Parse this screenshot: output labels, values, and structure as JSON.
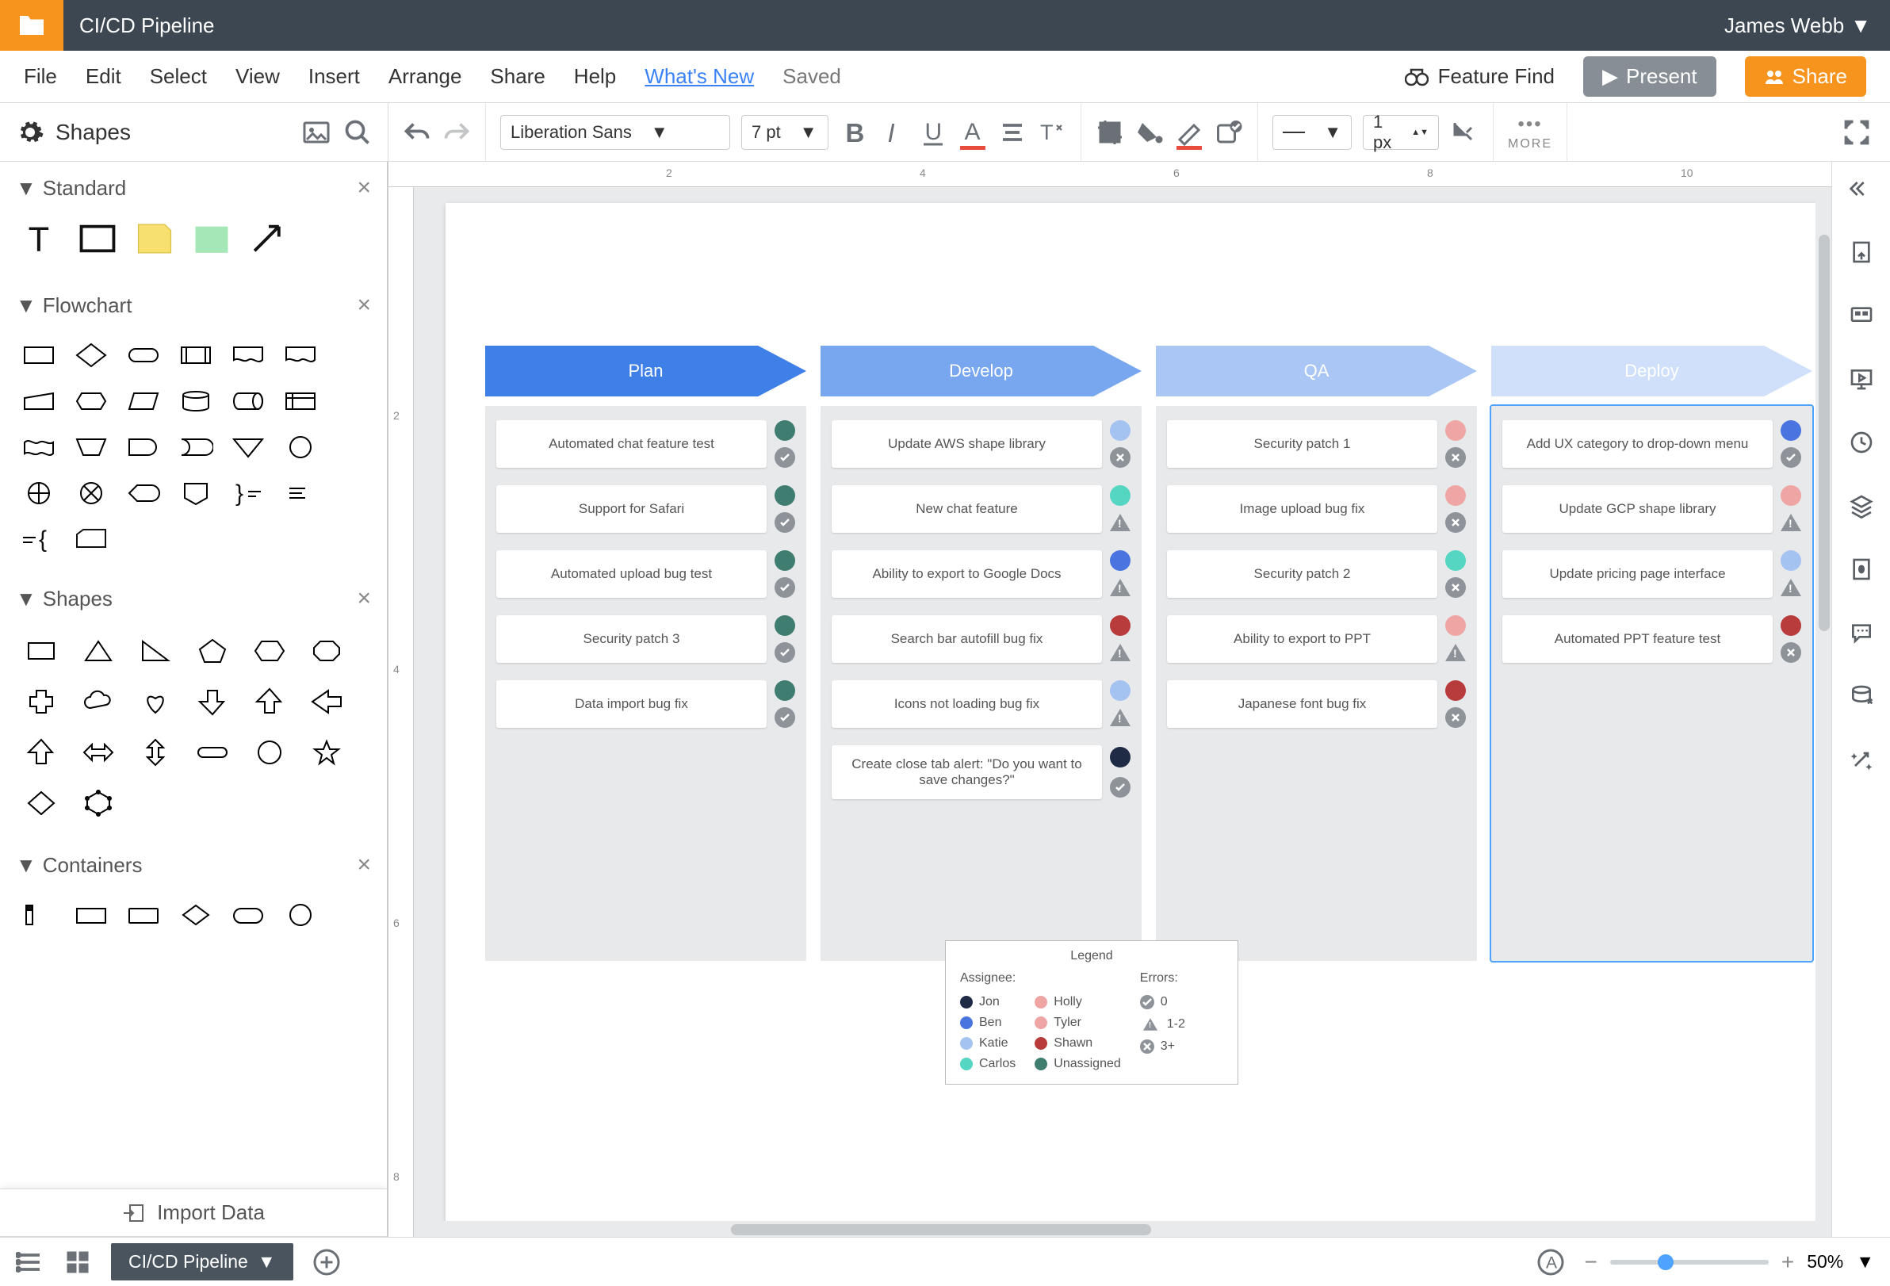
{
  "header": {
    "doc_title": "CI/CD Pipeline",
    "user": "James Webb"
  },
  "menu": {
    "items": [
      "File",
      "Edit",
      "Select",
      "View",
      "Insert",
      "Arrange",
      "Share",
      "Help"
    ],
    "whats_new": "What's New",
    "saved": "Saved",
    "feature_find": "Feature Find",
    "present": "Present",
    "share": "Share"
  },
  "toolbar": {
    "shapes_label": "Shapes",
    "font": "Liberation Sans",
    "font_size": "7 pt",
    "line_width": "1 px",
    "more": "MORE"
  },
  "panels": {
    "standard": "Standard",
    "flowchart": "Flowchart",
    "shapes": "Shapes",
    "containers": "Containers",
    "import_data": "Import Data"
  },
  "colors": {
    "plan": "#3f80e8",
    "develop": "#78a7f0",
    "qa": "#a9c6f4",
    "deploy": "#d0e0fa",
    "teal_dk": "#3f7d70",
    "teal_lt": "#55d6c2",
    "blue_med": "#4a74e0",
    "blue_lt": "#a5c3f0",
    "navy": "#1f2a44",
    "red": "#b83c3c",
    "pink": "#f0a5a5",
    "grey": "#8d9399"
  },
  "stages": [
    {
      "name": "Plan",
      "color_key": "plan",
      "cards": [
        {
          "text": "Automated chat feature test",
          "dot": "teal_dk",
          "status": "ok"
        },
        {
          "text": "Support for Safari",
          "dot": "teal_dk",
          "status": "ok"
        },
        {
          "text": "Automated upload bug test",
          "dot": "teal_dk",
          "status": "ok"
        },
        {
          "text": "Security patch 3",
          "dot": "teal_dk",
          "status": "ok"
        },
        {
          "text": "Data import bug fix",
          "dot": "teal_dk",
          "status": "ok"
        }
      ]
    },
    {
      "name": "Develop",
      "color_key": "develop",
      "cards": [
        {
          "text": "Update AWS shape library",
          "dot": "blue_lt",
          "status": "x"
        },
        {
          "text": "New chat feature",
          "dot": "teal_lt",
          "status": "warn"
        },
        {
          "text": "Ability to export to Google Docs",
          "dot": "blue_med",
          "status": "warn"
        },
        {
          "text": "Search bar autofill bug fix",
          "dot": "red",
          "status": "warn"
        },
        {
          "text": "Icons not loading bug fix",
          "dot": "blue_lt",
          "status": "warn"
        },
        {
          "text": "Create close tab alert: \"Do you want to save changes?\"",
          "dot": "navy",
          "status": "ok"
        }
      ]
    },
    {
      "name": "QA",
      "color_key": "qa",
      "cards": [
        {
          "text": "Security patch 1",
          "dot": "pink",
          "status": "x"
        },
        {
          "text": "Image upload bug fix",
          "dot": "pink",
          "status": "x"
        },
        {
          "text": "Security patch 2",
          "dot": "teal_lt",
          "status": "x"
        },
        {
          "text": "Ability to export to PPT",
          "dot": "pink",
          "status": "warn"
        },
        {
          "text": "Japanese font bug fix",
          "dot": "red",
          "status": "x"
        }
      ]
    },
    {
      "name": "Deploy",
      "color_key": "deploy",
      "selected": true,
      "cards": [
        {
          "text": "Add UX category to drop-down menu",
          "dot": "blue_med",
          "status": "ok"
        },
        {
          "text": "Update GCP shape library",
          "dot": "pink",
          "status": "warn"
        },
        {
          "text": "Update pricing page interface",
          "dot": "blue_lt",
          "status": "warn"
        },
        {
          "text": "Automated PPT feature test",
          "dot": "red",
          "status": "x"
        }
      ]
    }
  ],
  "legend": {
    "title": "Legend",
    "assignee_label": "Assignee:",
    "errors_label": "Errors:",
    "assignees": [
      {
        "name": "Jon",
        "color": "navy"
      },
      {
        "name": "Ben",
        "color": "blue_med"
      },
      {
        "name": "Katie",
        "color": "blue_lt"
      },
      {
        "name": "Carlos",
        "color": "teal_lt"
      },
      {
        "name": "Holly",
        "color": "pink"
      },
      {
        "name": "Tyler",
        "color": "pink"
      },
      {
        "name": "Shawn",
        "color": "red"
      },
      {
        "name": "Unassigned",
        "color": "teal_dk"
      }
    ],
    "errors": [
      {
        "icon": "ok",
        "label": "0"
      },
      {
        "icon": "warn",
        "label": "1-2"
      },
      {
        "icon": "x",
        "label": "3+"
      }
    ]
  },
  "ruler": {
    "h": [
      "2",
      "4",
      "6",
      "8",
      "10"
    ],
    "v": [
      "2",
      "4",
      "6",
      "8"
    ]
  },
  "bottom": {
    "tab": "CI/CD Pipeline",
    "zoom": "50%"
  }
}
